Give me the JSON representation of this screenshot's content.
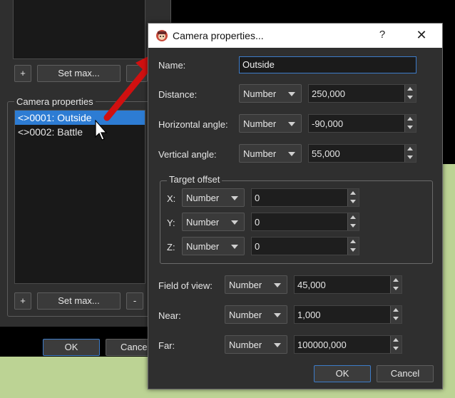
{
  "back_window": {
    "top_add_label": "+",
    "top_setmax_label": "Set max...",
    "group_title": "Camera properties",
    "cameras": [
      "<>0001: Outside",
      "<>0002: Battle"
    ],
    "bottom_add_label": "+",
    "bottom_setmax_label": "Set max...",
    "bottom_remove_label": "-",
    "ok_label": "OK",
    "cancel_label": "Cancel"
  },
  "dialog": {
    "title": "Camera properties...",
    "help_label": "?",
    "close_label": "✕",
    "name_label": "Name:",
    "name_value": "Outside",
    "fields": [
      {
        "label": "Distance:",
        "mode": "Number",
        "value": "250,000"
      },
      {
        "label": "Horizontal angle:",
        "mode": "Number",
        "value": "-90,000"
      },
      {
        "label": "Vertical angle:",
        "mode": "Number",
        "value": "55,000"
      }
    ],
    "target_offset": {
      "title": "Target offset",
      "x": {
        "label": "X:",
        "mode": "Number",
        "value": "0"
      },
      "y": {
        "label": "Y:",
        "mode": "Number",
        "value": "0"
      },
      "z": {
        "label": "Z:",
        "mode": "Number",
        "value": "0"
      }
    },
    "fov": {
      "label": "Field of view:",
      "mode": "Number",
      "value": "45,000"
    },
    "near": {
      "label": "Near:",
      "mode": "Number",
      "value": "1,000"
    },
    "far": {
      "label": "Far:",
      "mode": "Number",
      "value": "100000,000"
    },
    "ok_label": "OK",
    "cancel_label": "Cancel"
  },
  "colors": {
    "accent": "#3d7cc9",
    "selection": "#2d7cd3",
    "arrow": "#d01010",
    "panel": "#2f2f2f"
  }
}
